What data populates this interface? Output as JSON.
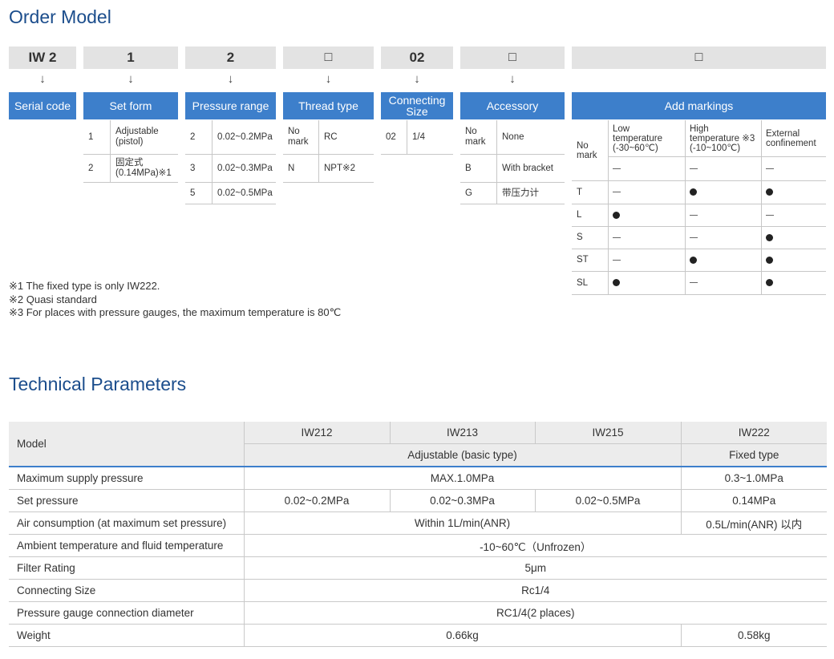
{
  "order_model": {
    "title": "Order Model",
    "columns": [
      {
        "code": "IW 2",
        "header": "Serial code"
      },
      {
        "code": "1",
        "header": "Set form",
        "rows": [
          {
            "k": "1",
            "v": "Adjustable\n(pistol)"
          },
          {
            "k": "2",
            "v": "固定式\n(0.14MPa)※1"
          }
        ]
      },
      {
        "code": "2",
        "header": "Pressure range",
        "rows": [
          {
            "k": "2",
            "v": "0.02~0.2MPa"
          },
          {
            "k": "3",
            "v": "0.02~0.3MPa"
          },
          {
            "k": "5",
            "v": "0.02~0.5MPa"
          }
        ]
      },
      {
        "code": "□",
        "header": "Thread type",
        "rows": [
          {
            "k": "No\nmark",
            "v": "RC"
          },
          {
            "k": "N",
            "v": "NPT※2"
          }
        ]
      },
      {
        "code": "02",
        "header": "Connecting\nSize",
        "rows": [
          {
            "k": "02",
            "v": "1/4"
          }
        ]
      },
      {
        "code": "□",
        "header": "Accessory",
        "rows": [
          {
            "k": "No\nmark",
            "v": "None"
          },
          {
            "k": "B",
            "v": "With bracket"
          },
          {
            "k": "G",
            "v": "带压力计"
          }
        ]
      },
      {
        "code": "□",
        "header": "Add markings"
      }
    ],
    "arrow": "↓",
    "markings": {
      "corner": "No\nmark",
      "headers": [
        "Low\ntemperature\n(-30~60℃)",
        "High\ntemperature ※3\n(-10~100℃)",
        "External\nconfinement"
      ],
      "rows": [
        {
          "k": "",
          "v": [
            "dash",
            "dash",
            "dash"
          ]
        },
        {
          "k": "T",
          "v": [
            "dash",
            "dot",
            "dot"
          ]
        },
        {
          "k": "L",
          "v": [
            "dot",
            "dash",
            "dash"
          ]
        },
        {
          "k": "S",
          "v": [
            "dash",
            "dash",
            "dot"
          ]
        },
        {
          "k": "ST",
          "v": [
            "dash",
            "dot",
            "dot"
          ]
        },
        {
          "k": "SL",
          "v": [
            "dot",
            "dash",
            "dot"
          ]
        }
      ]
    },
    "notes": [
      "※1 The fixed type is only IW222.",
      "※2 Quasi standard",
      "※3 For places with pressure gauges, the maximum temperature is 80℃"
    ]
  },
  "technical": {
    "title": "Technical Parameters",
    "model_label": "Model",
    "models": [
      "IW212",
      "IW213",
      "IW215",
      "IW222"
    ],
    "adjustable": "Adjustable (basic type)",
    "fixed": "Fixed type",
    "rows": {
      "max_pressure": {
        "label": "Maximum supply pressure",
        "adj": "MAX.1.0MPa",
        "fix": "0.3~1.0MPa"
      },
      "set_pressure": {
        "label": "Set pressure",
        "v1": "0.02~0.2MPa",
        "v2": "0.02~0.3MPa",
        "v3": "0.02~0.5MPa",
        "fix": "0.14MPa"
      },
      "air": {
        "label": "Air consumption (at maximum set pressure)",
        "adj": "Within 1L/min(ANR)",
        "fix": "0.5L/min(ANR) 以内"
      },
      "ambient": {
        "label": "Ambient temperature and fluid temperature",
        "all": "-10~60℃（Unfrozen）"
      },
      "filter": {
        "label": "Filter Rating",
        "all": "5μm"
      },
      "connecting": {
        "label": "Connecting Size",
        "all": "Rc1/4"
      },
      "gauge": {
        "label": "Pressure gauge connection diameter",
        "all": "RC1/4(2 places)"
      },
      "weight": {
        "label": "Weight",
        "adj": "0.66kg",
        "fix": "0.58kg"
      }
    }
  }
}
